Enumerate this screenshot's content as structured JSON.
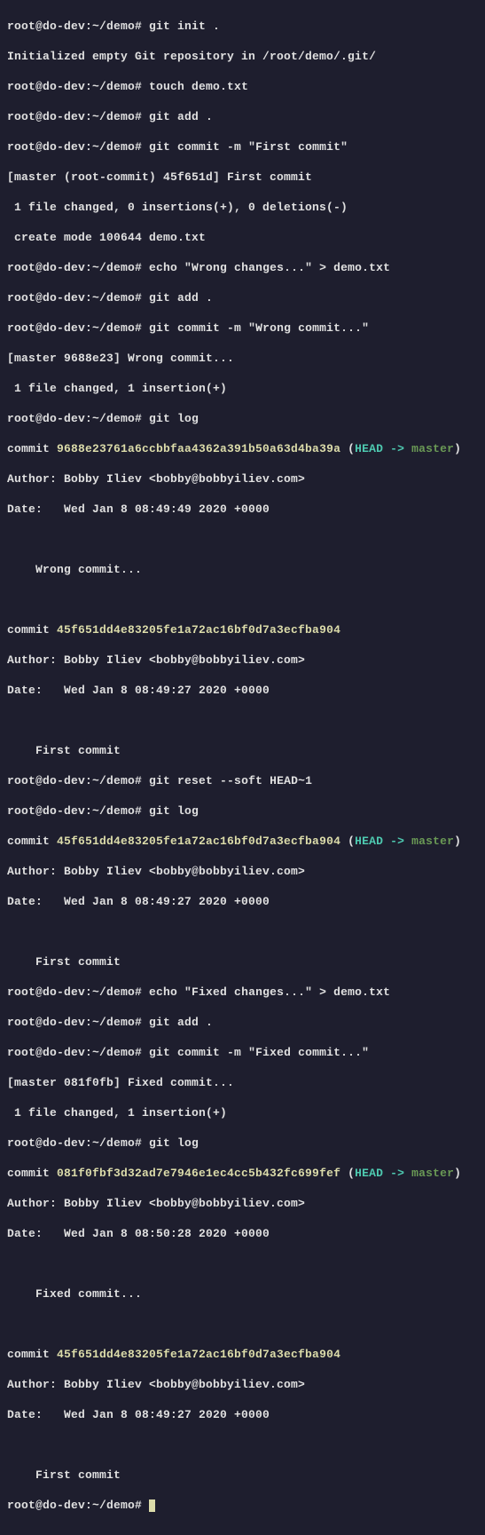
{
  "prompt_base": "root@do-dev:~/demo#",
  "cmds": {
    "c1": "git init .",
    "c2": "touch demo.txt",
    "c3": "git add .",
    "c4": "git commit -m \"First commit\"",
    "c5": "echo \"Wrong changes...\" > demo.txt",
    "c6": "git add .",
    "c7": "git commit -m \"Wrong commit...\"",
    "c8": "git log",
    "c9": "git reset --soft HEAD~1",
    "c10": "git log",
    "c11": "echo \"Fixed changes...\" > demo.txt",
    "c12": "git add .",
    "c13": "git commit -m \"Fixed commit...\"",
    "c14": "git log"
  },
  "out": {
    "init": "Initialized empty Git repository in /root/demo/.git/",
    "commit1_summary": "[master (root-commit) 45f651d] First commit",
    "commit1_stats": " 1 file changed, 0 insertions(+), 0 deletions(-)",
    "commit1_mode": " create mode 100644 demo.txt",
    "commit2_summary": "[master 9688e23] Wrong commit...",
    "commit2_stats": " 1 file changed, 1 insertion(+)",
    "commit3_summary": "[master 081f0fb] Fixed commit...",
    "commit3_stats": " 1 file changed, 1 insertion(+)"
  },
  "log1": {
    "c1_prefix": "commit ",
    "c1_hash": "9688e23761a6ccbbfaa4362a391b50a63d4ba39a",
    "head_open": " (",
    "head": "HEAD -> ",
    "branch": "master",
    "head_close": ")",
    "c1_author": "Author: Bobby Iliev <bobby@bobbyiliev.com>",
    "c1_date": "Date:   Wed Jan 8 08:49:49 2020 +0000",
    "c1_msg": "    Wrong commit...",
    "c2_prefix": "commit ",
    "c2_hash": "45f651dd4e83205fe1a72ac16bf0d7a3ecfba904",
    "c2_author": "Author: Bobby Iliev <bobby@bobbyiliev.com>",
    "c2_date": "Date:   Wed Jan 8 08:49:27 2020 +0000",
    "c2_msg": "    First commit"
  },
  "log2": {
    "c1_prefix": "commit ",
    "c1_hash": "45f651dd4e83205fe1a72ac16bf0d7a3ecfba904",
    "head_open": " (",
    "head": "HEAD -> ",
    "branch": "master",
    "head_close": ")",
    "c1_author": "Author: Bobby Iliev <bobby@bobbyiliev.com>",
    "c1_date": "Date:   Wed Jan 8 08:49:27 2020 +0000",
    "c1_msg": "    First commit"
  },
  "log3": {
    "c1_prefix": "commit ",
    "c1_hash": "081f0fbf3d32ad7e7946e1ec4cc5b432fc699fef",
    "head_open": " (",
    "head": "HEAD -> ",
    "branch": "master",
    "head_close": ")",
    "c1_author": "Author: Bobby Iliev <bobby@bobbyiliev.com>",
    "c1_date": "Date:   Wed Jan 8 08:50:28 2020 +0000",
    "c1_msg": "    Fixed commit...",
    "c2_prefix": "commit ",
    "c2_hash": "45f651dd4e83205fe1a72ac16bf0d7a3ecfba904",
    "c2_author": "Author: Bobby Iliev <bobby@bobbyiliev.com>",
    "c2_date": "Date:   Wed Jan 8 08:49:27 2020 +0000",
    "c2_msg": "    First commit"
  }
}
